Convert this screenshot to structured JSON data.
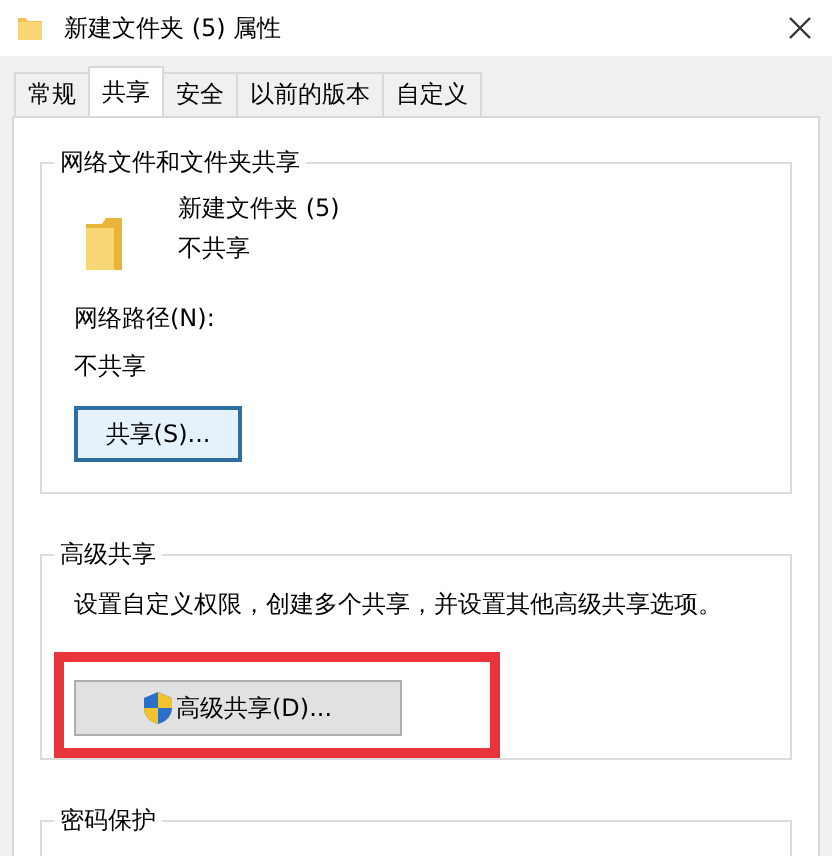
{
  "window": {
    "title": "新建文件夹 (5) 属性"
  },
  "tabs": [
    {
      "label": "常规",
      "selected": false
    },
    {
      "label": "共享",
      "selected": true
    },
    {
      "label": "安全",
      "selected": false
    },
    {
      "label": "以前的版本",
      "selected": false
    },
    {
      "label": "自定义",
      "selected": false
    }
  ],
  "network_sharing": {
    "title": "网络文件和文件夹共享",
    "folder_name": "新建文件夹 (5)",
    "folder_status": "不共享",
    "path_label": "网络路径(N):",
    "path_value": "不共享",
    "button": {
      "label": "共享(S)...",
      "focused": true
    }
  },
  "advanced_sharing": {
    "title": "高级共享",
    "description": "设置自定义权限，创建多个共享，并设置其他高级共享选项。",
    "button": {
      "label": "高级共享(D)...",
      "highlighted": true
    }
  },
  "password_protection": {
    "title": "密码保护"
  }
}
